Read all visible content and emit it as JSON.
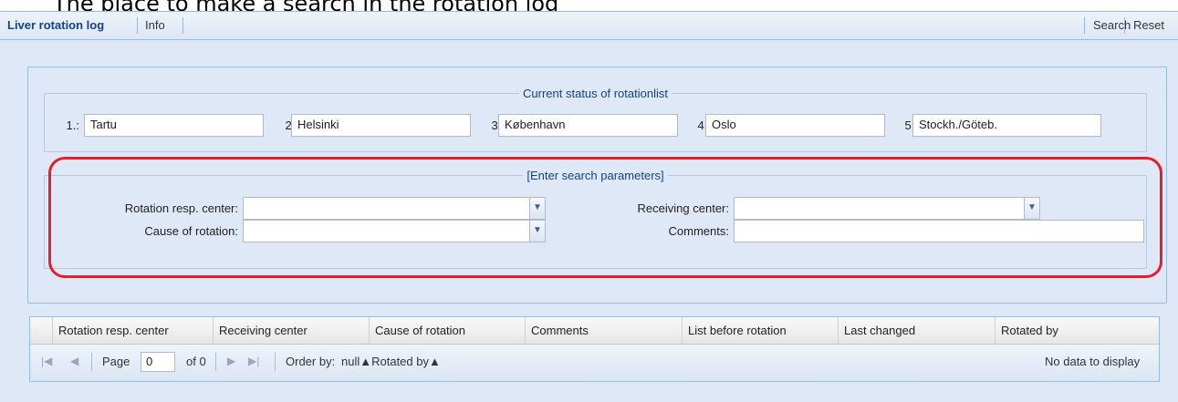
{
  "heading": "The place to make a search in the rotation log",
  "toolbar": {
    "title": "Liver rotation log",
    "info": "Info",
    "search": "Search",
    "reset": "Reset"
  },
  "status": {
    "legend": "Current status of rotationlist",
    "items": [
      {
        "label": "1.:",
        "value": "Tartu"
      },
      {
        "label": "2.:",
        "value": "Helsinki"
      },
      {
        "label": "3.:",
        "value": "København"
      },
      {
        "label": "4.:",
        "value": "Oslo"
      },
      {
        "label": "5.:",
        "value": "Stockh./Göteb."
      }
    ]
  },
  "search": {
    "legend": "[Enter search parameters]",
    "rotation_center_label": "Rotation resp. center:",
    "rotation_center_value": "",
    "receiving_center_label": "Receiving center:",
    "receiving_center_value": "",
    "cause_label": "Cause of rotation:",
    "cause_value": "",
    "comments_label": "Comments:",
    "comments_value": ""
  },
  "grid": {
    "columns": [
      "Rotation resp. center",
      "Receiving center",
      "Cause of rotation",
      "Comments",
      "List before rotation",
      "Last changed",
      "Rotated by"
    ],
    "rows": []
  },
  "pager": {
    "page_label": "Page",
    "page_value": "0",
    "of_label": "of 0",
    "order_by_label": "Order by:",
    "order_by_value": "null▲Rotated by▲",
    "empty_text": "No data to display"
  },
  "colors": {
    "accent": "#15428b",
    "highlight": "#e5202e",
    "panel_bg": "#dfe8f6"
  },
  "icons": {
    "combo_arrow": "chevron-down-icon",
    "pager": [
      "first-page-icon",
      "prev-page-icon",
      "next-page-icon",
      "last-page-icon"
    ]
  }
}
